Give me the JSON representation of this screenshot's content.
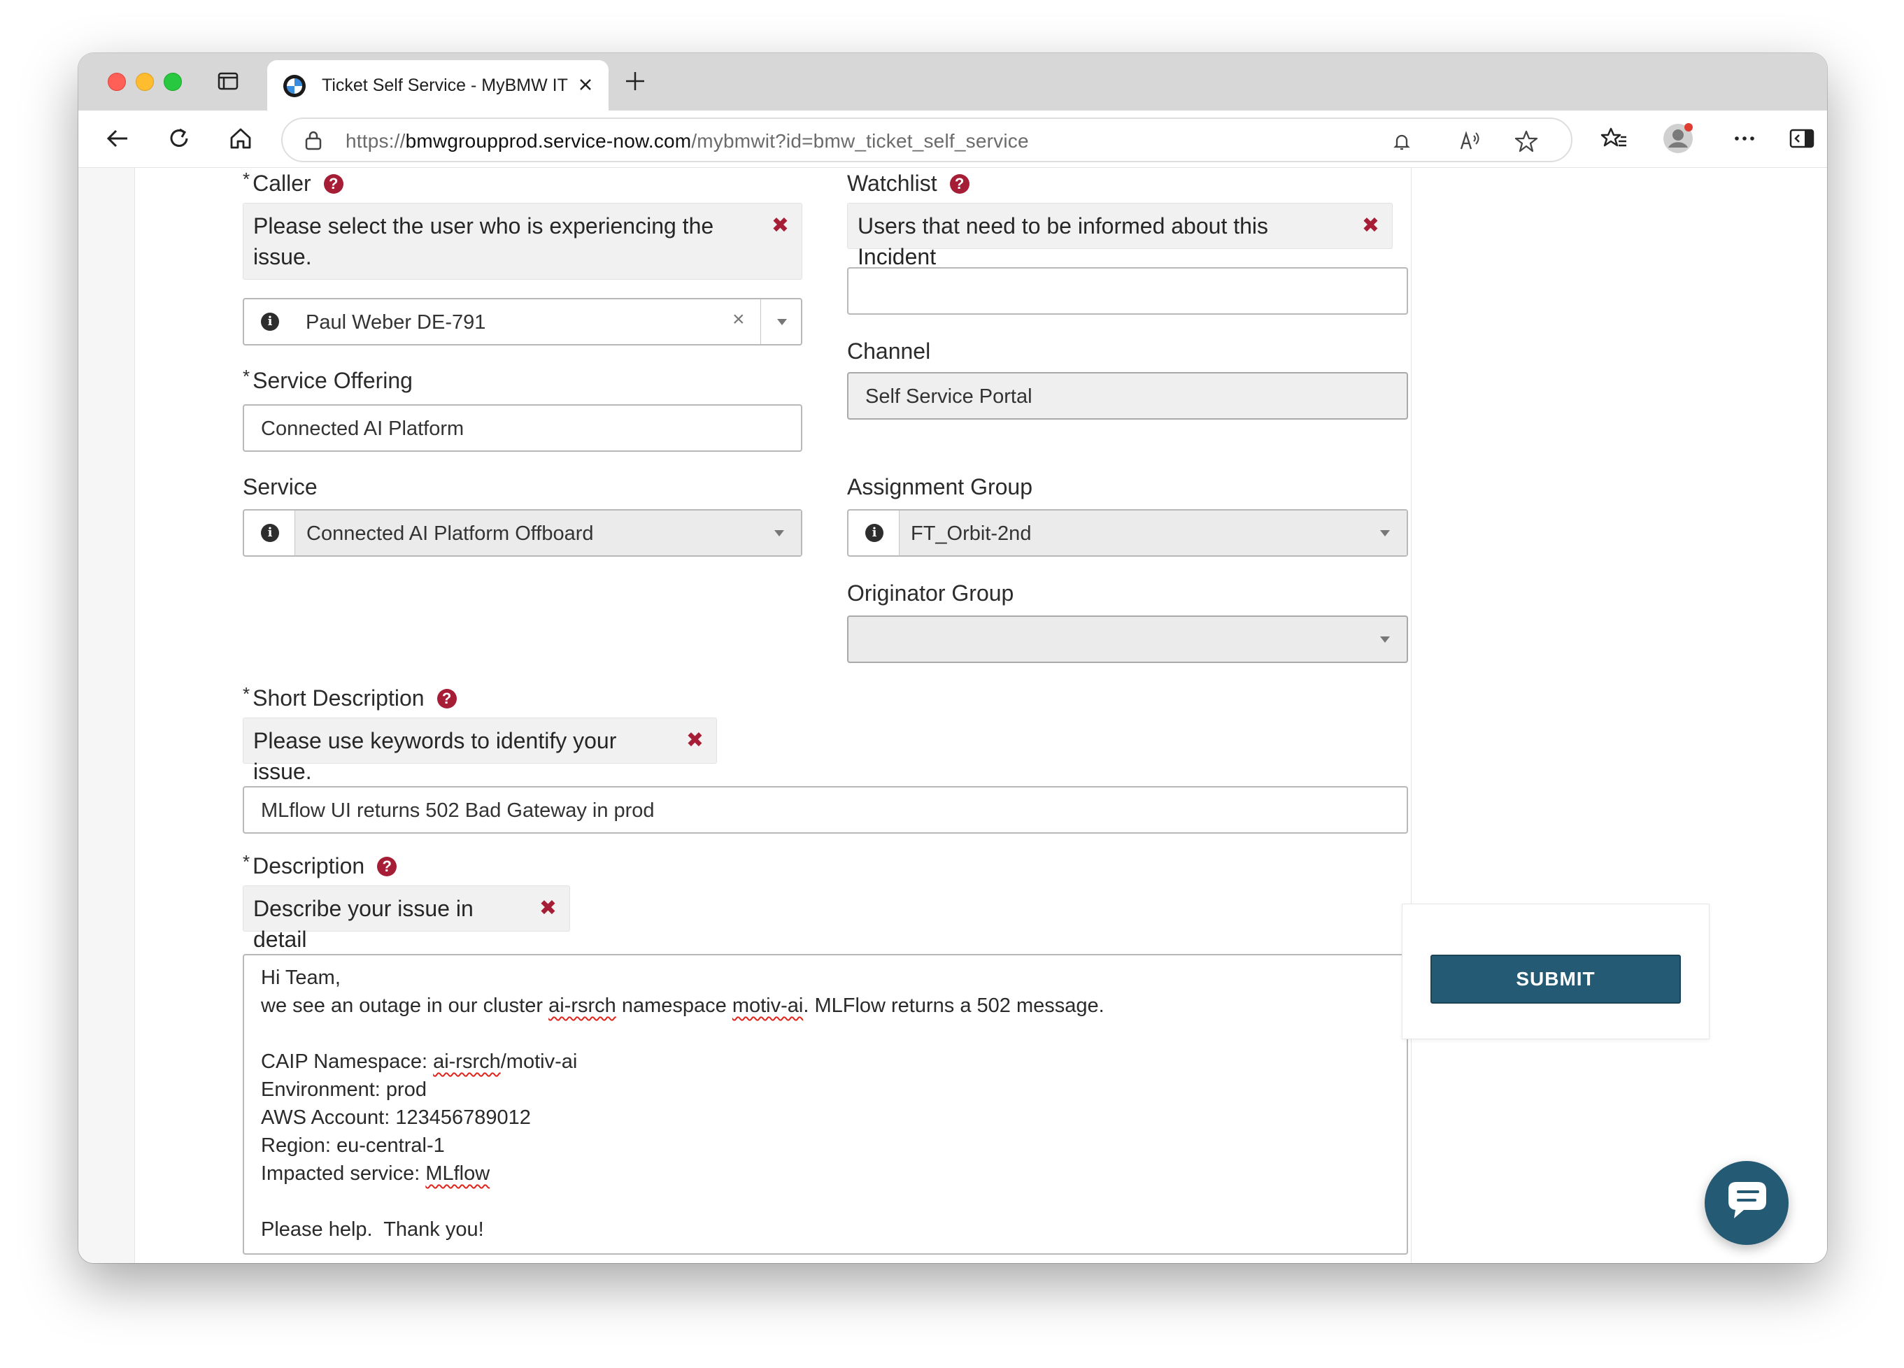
{
  "browser": {
    "tab_title": "Ticket Self Service - MyBMW IT",
    "url_scheme": "https://",
    "url_host": "bmwgroupprod.service-now.com",
    "url_path": "/mybmwit?id=bmw_ticket_self_service"
  },
  "form": {
    "caller": {
      "label": "Caller",
      "required_mark": "*",
      "hint": "Please select the user who is experiencing the issue.",
      "hint_close": "✖",
      "value": "Paul Weber DE-791",
      "clear": "×"
    },
    "watchlist": {
      "label": "Watchlist",
      "hint": "Users that need to be informed about this Incident",
      "hint_close": "✖",
      "value": ""
    },
    "service_offering": {
      "label": "Service Offering",
      "required_mark": "*",
      "value": "Connected AI Platform"
    },
    "channel": {
      "label": "Channel",
      "value": "Self Service Portal"
    },
    "service": {
      "label": "Service",
      "value": "Connected AI Platform Offboard"
    },
    "assignment_group": {
      "label": "Assignment Group",
      "value": "FT_Orbit-2nd"
    },
    "originator_group": {
      "label": "Originator Group",
      "value": ""
    },
    "short_description": {
      "label": "Short Description",
      "required_mark": "*",
      "hint": "Please use keywords to identify your issue.",
      "hint_close": "✖",
      "value": "MLflow UI returns 502 Bad Gateway in prod"
    },
    "description": {
      "label": "Description",
      "required_mark": "*",
      "hint": "Describe your issue in detail",
      "hint_close": "✖",
      "lines": {
        "l1": "Hi Team,",
        "l2a": "we see an outage in our cluster ",
        "l2b": "ai-rsrch",
        "l2c": " namespace ",
        "l2d": "motiv-ai",
        "l2e": ". MLFlow returns a 502 message.",
        "l4a": "CAIP Namespace: ",
        "l4b": "ai-rsrch",
        "l4c": "/motiv-ai",
        "l5": "Environment: prod",
        "l6": "AWS Account: 123456789012",
        "l7": "Region: eu-central-1",
        "l8a": "Impacted service: ",
        "l8b": "MLflow",
        "l10": "Please help.  Thank you!"
      }
    },
    "help_glyph": "?",
    "info_glyph": "i"
  },
  "actions": {
    "submit_label": "SUBMIT"
  },
  "colors": {
    "accent": "#245a73",
    "required_red": "#a51e36"
  }
}
